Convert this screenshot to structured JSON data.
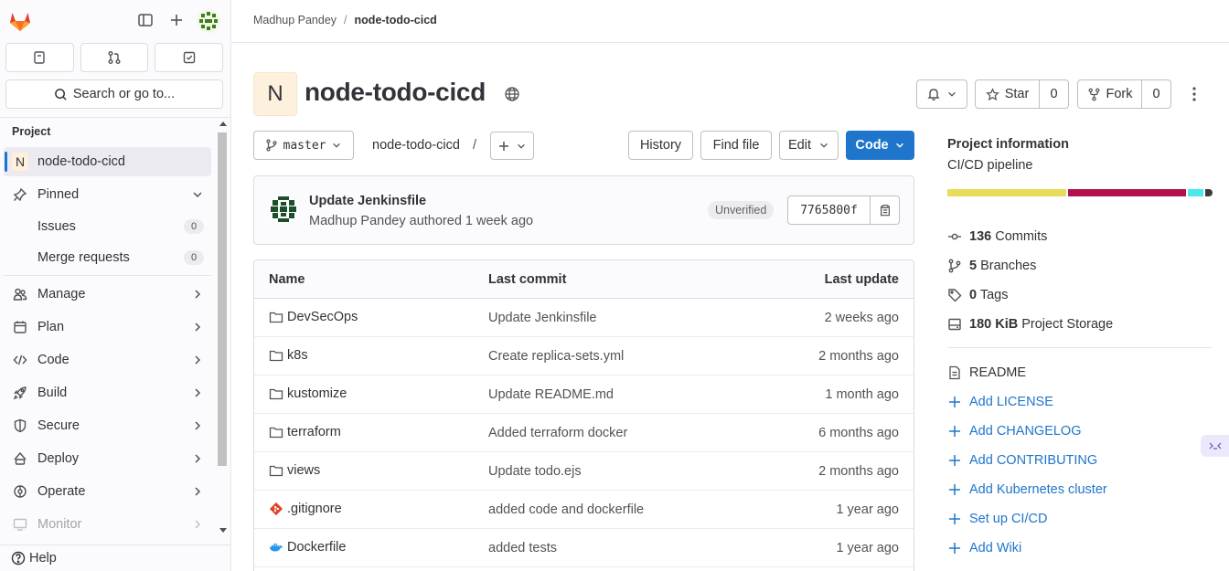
{
  "sidebar": {
    "search_label": "Search or go to...",
    "section_title": "Project",
    "project_item": {
      "avatar_letter": "N",
      "label": "node-todo-cicd"
    },
    "pinned_label": "Pinned",
    "pinned_items": [
      {
        "label": "Issues",
        "count": "0"
      },
      {
        "label": "Merge requests",
        "count": "0"
      }
    ],
    "nav_items": [
      {
        "label": "Manage",
        "icon": "manage-icon"
      },
      {
        "label": "Plan",
        "icon": "plan-icon"
      },
      {
        "label": "Code",
        "icon": "code-icon"
      },
      {
        "label": "Build",
        "icon": "rocket-icon"
      },
      {
        "label": "Secure",
        "icon": "shield-icon"
      },
      {
        "label": "Deploy",
        "icon": "deploy-icon"
      },
      {
        "label": "Operate",
        "icon": "operate-icon"
      },
      {
        "label": "Monitor",
        "icon": "monitor-icon"
      }
    ],
    "help_label": "Help"
  },
  "breadcrumb": {
    "owner": "Madhup Pandey",
    "project": "node-todo-cicd"
  },
  "project": {
    "avatar_letter": "N",
    "title": "node-todo-cicd",
    "star_label": "Star",
    "star_count": "0",
    "fork_label": "Fork",
    "fork_count": "0"
  },
  "toolbar": {
    "branch": "master",
    "path": "node-todo-cicd",
    "path_sep": "/",
    "history_label": "History",
    "find_file_label": "Find file",
    "edit_label": "Edit",
    "code_label": "Code"
  },
  "commit": {
    "title": "Update Jenkinsfile",
    "meta": "Madhup Pandey authored 1 week ago",
    "badge": "Unverified",
    "sha": "7765800f"
  },
  "files": {
    "headers": {
      "name": "Name",
      "last_commit": "Last commit",
      "last_update": "Last update"
    },
    "rows": [
      {
        "name": "DevSecOps",
        "type": "folder",
        "message": "Update Jenkinsfile",
        "updated": "2 weeks ago"
      },
      {
        "name": "k8s",
        "type": "folder",
        "message": "Create replica-sets.yml",
        "updated": "2 months ago"
      },
      {
        "name": "kustomize",
        "type": "folder",
        "message": "Update README.md",
        "updated": "1 month ago"
      },
      {
        "name": "terraform",
        "type": "folder",
        "message": "Added terraform docker",
        "updated": "6 months ago"
      },
      {
        "name": "views",
        "type": "folder",
        "message": "Update todo.ejs",
        "updated": "2 months ago"
      },
      {
        "name": ".gitignore",
        "type": "git",
        "message": "added code and dockerfile",
        "updated": "1 year ago"
      },
      {
        "name": "Dockerfile",
        "type": "docker",
        "message": "added tests",
        "updated": "1 year ago"
      }
    ]
  },
  "info": {
    "title": "Project information",
    "description": "CI/CD pipeline",
    "language_colors": [
      "#e9dc5b",
      "#b1124d",
      "#4ce7e7",
      "#3a3a3a"
    ],
    "stats": [
      {
        "value": "136",
        "label": "Commits",
        "icon": "commit-icon"
      },
      {
        "value": "5",
        "label": "Branches",
        "icon": "branch-icon"
      },
      {
        "value": "0",
        "label": "Tags",
        "icon": "tag-icon"
      },
      {
        "value": "180 KiB",
        "label": "Project Storage",
        "icon": "storage-icon"
      }
    ],
    "readme_label": "README",
    "links": [
      "Add LICENSE",
      "Add CHANGELOG",
      "Add CONTRIBUTING",
      "Add Kubernetes cluster",
      "Set up CI/CD",
      "Add Wiki"
    ]
  },
  "colors": {
    "accent": "#1f75cb",
    "project_avatar_bg": "#fdf1dd",
    "logo_orange": "#e24329"
  }
}
